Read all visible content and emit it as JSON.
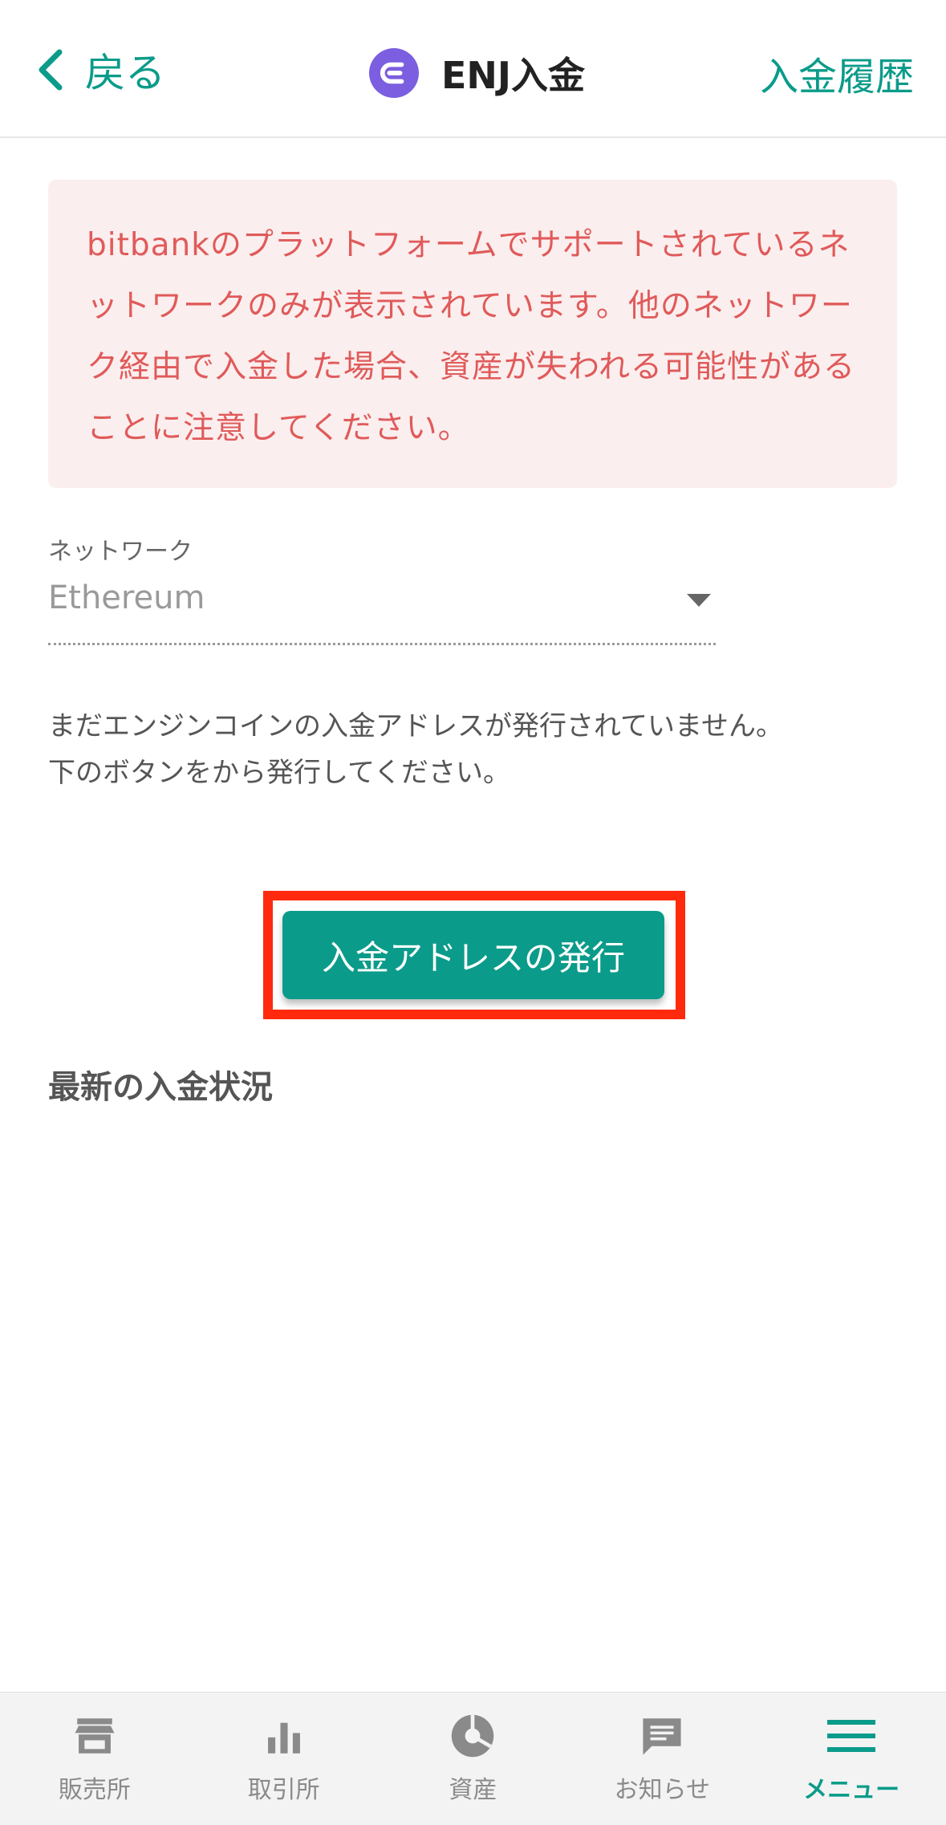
{
  "header": {
    "back_label": "戻る",
    "title": "ENJ入金",
    "history_label": "入金履歴",
    "logo_icon": "enjin-logo-icon",
    "accent_color": "#0b9b8a"
  },
  "warning": {
    "text": "bitbankのプラットフォームでサポートされているネットワークのみが表示されています。他のネットワーク経由で入金した場合、資産が失われる可能性があることに注意してください。",
    "text_color": "#e05a5a",
    "bg_color": "#fbeeee"
  },
  "network": {
    "label": "ネットワーク",
    "selected": "Ethereum"
  },
  "info": {
    "line1": "まだエンジンコインの入金アドレスが発行されていません。",
    "line2": "下のボタンをから発行してください。"
  },
  "issue_button": {
    "label": "入金アドレスの発行",
    "highlight_color": "#ff2a0e"
  },
  "latest_section": {
    "title": "最新の入金状況"
  },
  "bottom_nav": {
    "items": [
      {
        "label": "販売所",
        "icon": "store-icon"
      },
      {
        "label": "取引所",
        "icon": "bar-chart-icon"
      },
      {
        "label": "資産",
        "icon": "pie-chart-icon"
      },
      {
        "label": "お知らせ",
        "icon": "message-icon"
      },
      {
        "label": "メニュー",
        "icon": "menu-icon",
        "active": true
      }
    ]
  }
}
